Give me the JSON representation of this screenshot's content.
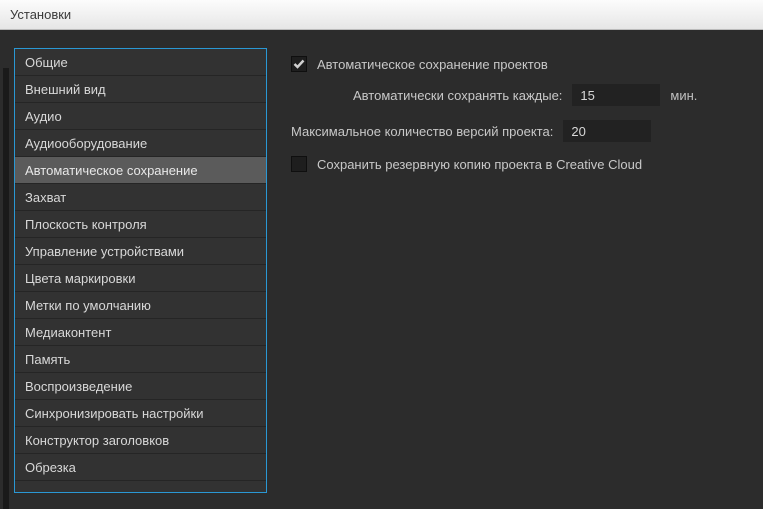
{
  "window": {
    "title": "Установки"
  },
  "sidebar": {
    "items": [
      {
        "label": "Общие"
      },
      {
        "label": "Внешний вид"
      },
      {
        "label": "Аудио"
      },
      {
        "label": "Аудиооборудование"
      },
      {
        "label": "Автоматическое сохранение"
      },
      {
        "label": "Захват"
      },
      {
        "label": "Плоскость контроля"
      },
      {
        "label": "Управление устройствами"
      },
      {
        "label": "Цвета маркировки"
      },
      {
        "label": "Метки по умолчанию"
      },
      {
        "label": "Медиаконтент"
      },
      {
        "label": "Память"
      },
      {
        "label": "Воспроизведение"
      },
      {
        "label": "Синхронизировать настройки"
      },
      {
        "label": "Конструктор заголовков"
      },
      {
        "label": "Обрезка"
      }
    ],
    "selected_index": 4
  },
  "main": {
    "autosave_checkbox_label": "Автоматическое сохранение проектов",
    "autosave_checked": true,
    "interval_label": "Автоматически сохранять каждые:",
    "interval_value": "15",
    "interval_unit": "мин.",
    "max_versions_label": "Максимальное количество версий проекта:",
    "max_versions_value": "20",
    "backup_cloud_label": "Сохранить резервную копию проекта в Creative Cloud",
    "backup_cloud_checked": false
  }
}
